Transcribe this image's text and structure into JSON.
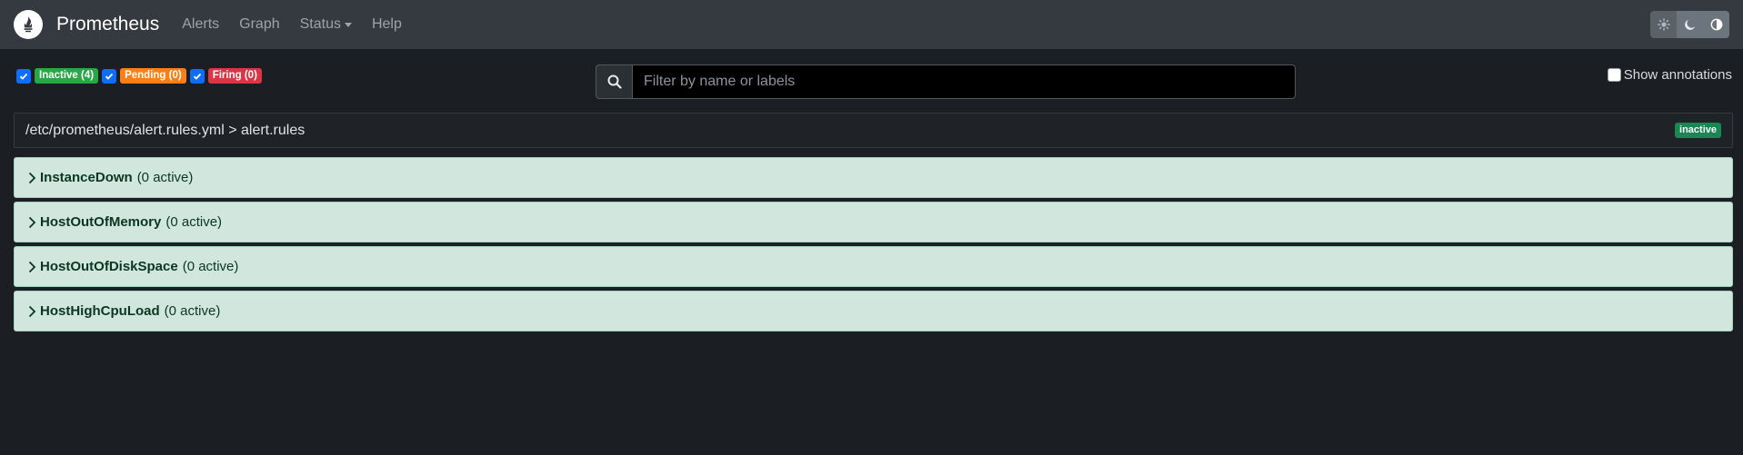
{
  "nav": {
    "brand": "Prometheus",
    "links": [
      "Alerts",
      "Graph",
      "Status",
      "Help"
    ]
  },
  "filters": [
    {
      "label": "Inactive (4)",
      "color": "#28a745",
      "checked": true
    },
    {
      "label": "Pending (0)",
      "color": "#fd7e14",
      "checked": true
    },
    {
      "label": "Firing (0)",
      "color": "#dc3545",
      "checked": true
    }
  ],
  "search": {
    "placeholder": "Filter by name or labels",
    "value": ""
  },
  "show_annotations": {
    "label": "Show annotations",
    "checked": false
  },
  "group": {
    "path": "/etc/prometheus/alert.rules.yml > alert.rules",
    "state": "inactive"
  },
  "rules": [
    {
      "name": "InstanceDown",
      "count": "(0 active)"
    },
    {
      "name": "HostOutOfMemory",
      "count": "(0 active)"
    },
    {
      "name": "HostOutOfDiskSpace",
      "count": "(0 active)"
    },
    {
      "name": "HostHighCpuLoad",
      "count": "(0 active)"
    }
  ],
  "colors": {
    "navbar": "#343a40",
    "background": "#1b1e23",
    "rule_bg": "#d1e7dd",
    "rule_text": "#0a3622"
  }
}
